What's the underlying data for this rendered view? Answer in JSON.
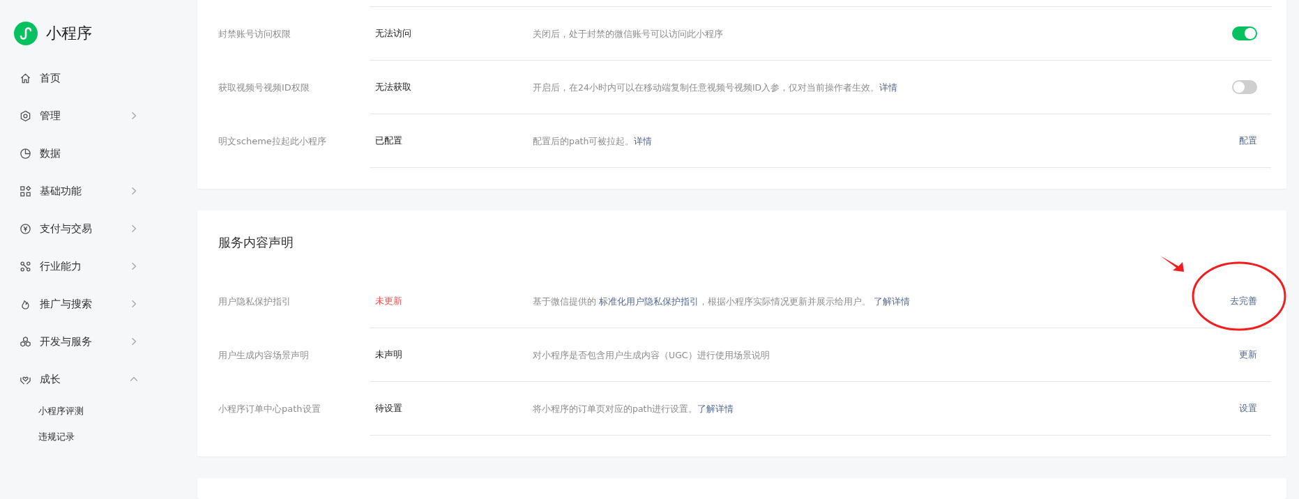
{
  "sidebar": {
    "logo_text": "小程序",
    "items": [
      {
        "label": "首页",
        "kind": "link"
      },
      {
        "label": "管理",
        "kind": "group",
        "expanded": false
      },
      {
        "label": "数据",
        "kind": "link"
      },
      {
        "label": "基础功能",
        "kind": "group",
        "expanded": false
      },
      {
        "label": "支付与交易",
        "kind": "group",
        "expanded": false
      },
      {
        "label": "行业能力",
        "kind": "group",
        "expanded": false
      },
      {
        "label": "推广与搜索",
        "kind": "group",
        "expanded": false
      },
      {
        "label": "开发与服务",
        "kind": "group",
        "expanded": false
      },
      {
        "label": "成长",
        "kind": "group",
        "expanded": true,
        "children": [
          {
            "label": "小程序评测"
          },
          {
            "label": "违规记录"
          }
        ]
      }
    ]
  },
  "cards": [
    {
      "rows": [
        {
          "label": "封禁账号访问权限",
          "status": "无法访问",
          "alert": false,
          "description": [
            {
              "kind": "text",
              "text": "关闭后，处于封禁的微信账号可以访问此小程序"
            }
          ],
          "action": {
            "kind": "toggle",
            "on": true
          }
        },
        {
          "label": "获取视频号视频ID权限",
          "status": "无法获取",
          "alert": false,
          "description": [
            {
              "kind": "text",
              "text": "开启后，在24小时内可以在移动端复制任意视频号视频ID入参，仅对当前操作者生效。"
            },
            {
              "kind": "link",
              "text": "详情"
            }
          ],
          "action": {
            "kind": "toggle",
            "on": false
          }
        },
        {
          "label": "明文scheme拉起此小程序",
          "status": "已配置",
          "alert": false,
          "description": [
            {
              "kind": "text",
              "text": "配置后的path可被拉起。"
            },
            {
              "kind": "link",
              "text": "详情"
            }
          ],
          "action": {
            "kind": "link",
            "label": "配置"
          }
        }
      ]
    },
    {
      "title": "服务内容声明",
      "rows": [
        {
          "label": "用户隐私保护指引",
          "status": "未更新",
          "alert": true,
          "description": [
            {
              "kind": "text",
              "text": "基于微信提供的 "
            },
            {
              "kind": "link",
              "text": "标准化用户隐私保护指引"
            },
            {
              "kind": "text",
              "text": "，根据小程序实际情况更新并展示给用户。 "
            },
            {
              "kind": "link",
              "text": "了解详情"
            }
          ],
          "action": {
            "kind": "link",
            "label": "去完善"
          }
        },
        {
          "label": "用户生成内容场景声明",
          "status": "未声明",
          "alert": false,
          "description": [
            {
              "kind": "text",
              "text": "对小程序是否包含用户生成内容（UGC）进行使用场景说明"
            }
          ],
          "action": {
            "kind": "link",
            "label": "更新"
          }
        },
        {
          "label": "小程序订单中心path设置",
          "status": "待设置",
          "alert": false,
          "description": [
            {
              "kind": "text",
              "text": "将小程序的订单页对应的path进行设置。"
            },
            {
              "kind": "link",
              "text": "了解详情"
            }
          ],
          "action": {
            "kind": "link",
            "label": "设置"
          }
        }
      ]
    }
  ]
}
